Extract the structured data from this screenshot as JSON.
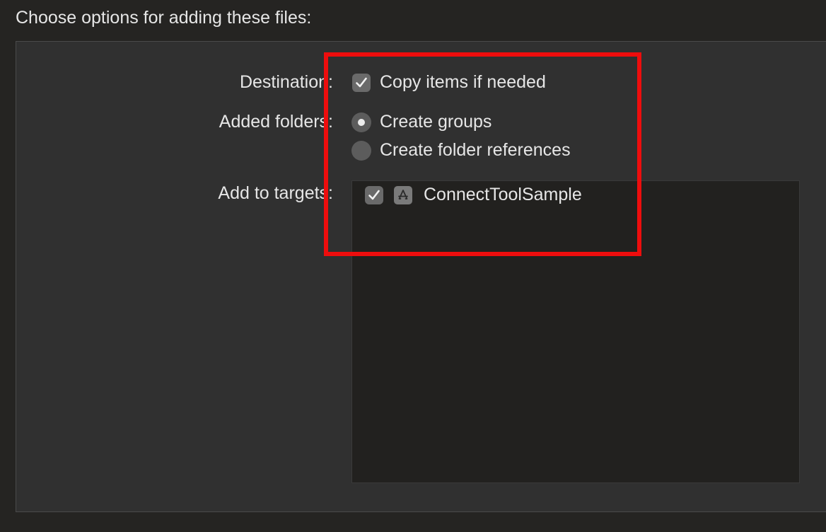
{
  "dialog": {
    "heading": "Choose options for adding these files:"
  },
  "destination": {
    "label": "Destination:",
    "option_label": "Copy items if needed",
    "checked": true
  },
  "added_folders": {
    "label": "Added folders:",
    "options": [
      {
        "label": "Create groups",
        "selected": true
      },
      {
        "label": "Create folder references",
        "selected": false
      }
    ]
  },
  "targets": {
    "label": "Add to targets:",
    "items": [
      {
        "name": "ConnectToolSample",
        "checked": true,
        "icon": "app-store-icon"
      }
    ]
  },
  "colors": {
    "highlight": "#ee0d0d",
    "panel_background": "#303030",
    "window_background": "#252422",
    "list_background": "#22211f"
  }
}
